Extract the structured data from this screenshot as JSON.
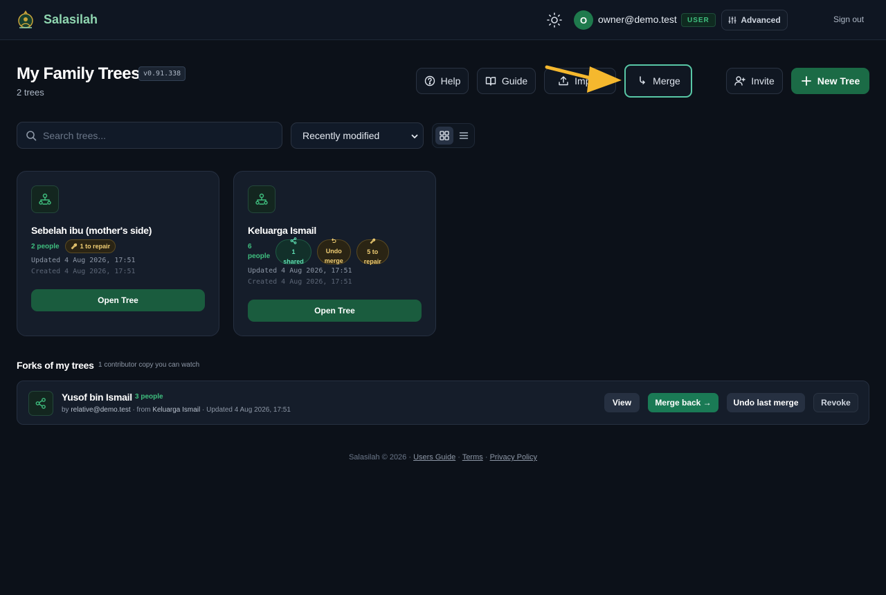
{
  "app": {
    "name": "Salasilah"
  },
  "user": {
    "initial": "O",
    "email": "owner@demo.test",
    "role": "USER"
  },
  "nav": {
    "advanced": "Advanced",
    "sign_out": "Sign out"
  },
  "header": {
    "title": "My Family Trees",
    "version": "v0.91.338",
    "count": "2 trees",
    "buttons": {
      "help": "Help",
      "guide": "Guide",
      "import": "Import",
      "merge": "Merge",
      "invite": "Invite",
      "new_tree": "New Tree"
    }
  },
  "toolbar": {
    "search_placeholder": "Search trees...",
    "sort_selected": "Recently modified",
    "view_mode": "grid"
  },
  "trees": [
    {
      "name": "Sebelah ibu (mother's side)",
      "people": "2 people",
      "repair": "1 to repair",
      "updated": "Updated 4 Aug 2026, 17:51",
      "created": "Created 4 Aug 2026, 17:51",
      "open": "Open Tree"
    },
    {
      "name": "Keluarga Ismail",
      "people_num": "6",
      "people_word": "people",
      "shared_num": "1",
      "shared_word": "shared",
      "undo_1": "Undo",
      "undo_2": "merge",
      "repair_1": "5 to",
      "repair_2": "repair",
      "updated": "Updated 4 Aug 2026, 17:51",
      "created": "Created 4 Aug 2026, 17:51",
      "open": "Open Tree"
    }
  ],
  "forks": {
    "title": "Forks of my trees",
    "subtitle": "1 contributor copy you can watch",
    "items": [
      {
        "name": "Yusof bin Ismail",
        "people": "3 people",
        "by_prefix": "by",
        "by": "relative@demo.test",
        "from_prefix": "· from",
        "from": "Keluarga Ismail",
        "updated": "· Updated 4 Aug 2026, 17:51",
        "view": "View",
        "merge_back": "Merge back →",
        "undo_merge": "Undo last merge",
        "revoke": "Revoke"
      }
    ]
  },
  "footer": {
    "copyright": "Salasilah © 2026 ·",
    "users_guide": "Users Guide",
    "sep": "·",
    "terms": "Terms",
    "privacy": "Privacy Policy"
  },
  "colors": {
    "accent": "#1b6b46",
    "brand_text": "#8fd6b0",
    "highlight_ring": "#58c8a6",
    "arrow": "#f5b82e"
  }
}
